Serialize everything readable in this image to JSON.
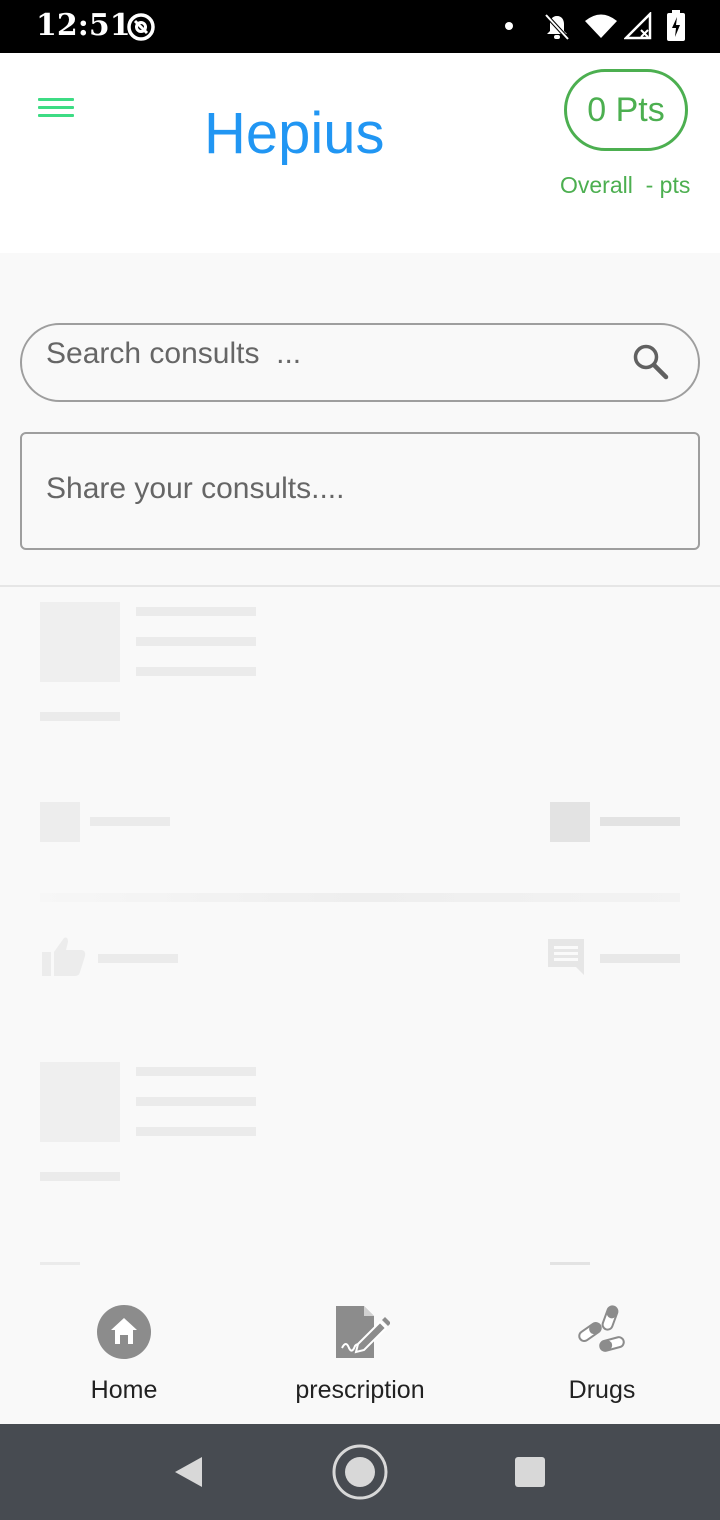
{
  "status_bar": {
    "time": "12:51",
    "icons": [
      "sync-icon",
      "notification-dot-icon",
      "mute-bell-icon",
      "wifi-icon",
      "no-signal-icon",
      "battery-charging-icon"
    ]
  },
  "header": {
    "app_title": "Hepius",
    "points_badge": "0 Pts",
    "overall_label": "Overall  - pts",
    "accent_color": "#2196f3",
    "points_color": "#4caf50",
    "menu_color": "#3ddc84"
  },
  "search": {
    "placeholder": "Search consults  ..."
  },
  "share": {
    "placeholder": "Share your consults...."
  },
  "bottom_nav": {
    "items": [
      {
        "label": "Home",
        "icon": "home-icon"
      },
      {
        "label": "prescription",
        "icon": "prescription-icon"
      },
      {
        "label": "Drugs",
        "icon": "pills-icon"
      }
    ]
  },
  "system_nav": {
    "buttons": [
      "back-icon",
      "home-circle-icon",
      "recents-icon"
    ]
  }
}
